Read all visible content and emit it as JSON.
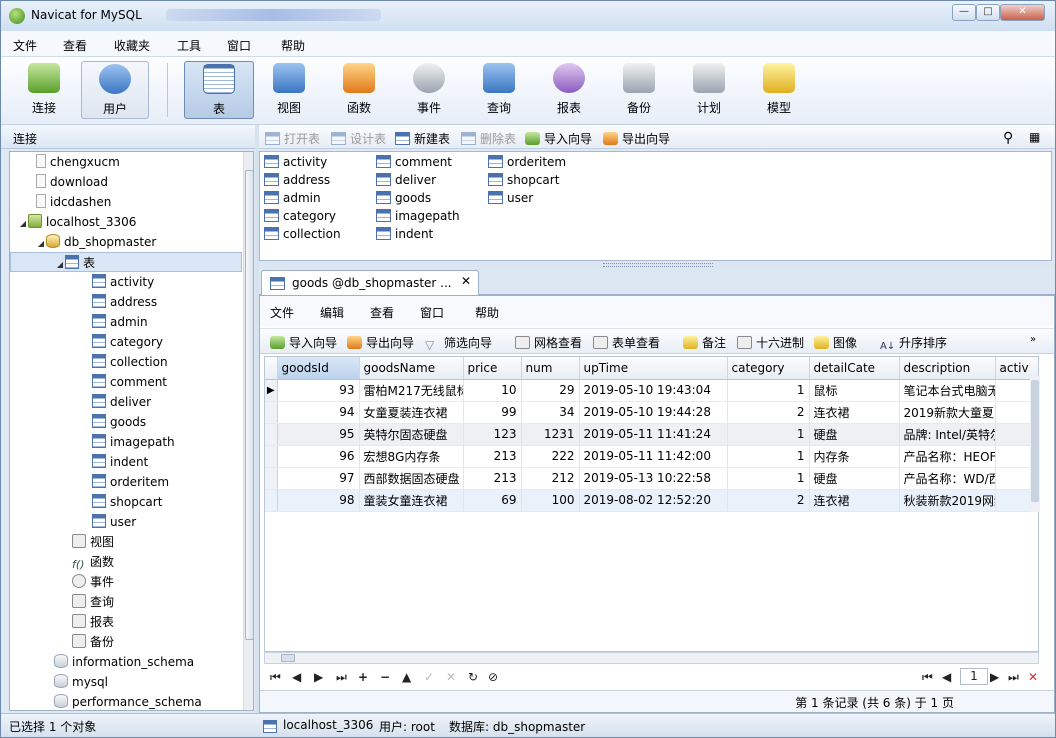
{
  "window": {
    "title": "Navicat for MySQL",
    "min": "—",
    "max": "□",
    "close": "✕"
  },
  "menu": [
    "文件",
    "查看",
    "收藏夹",
    "工具",
    "窗口",
    "帮助"
  ],
  "toolbar": [
    "连接",
    "用户",
    "表",
    "视图",
    "函数",
    "事件",
    "查询",
    "报表",
    "备份",
    "计划",
    "模型"
  ],
  "left_header": "连接",
  "tree": {
    "connections": [
      "chengxucm",
      "download",
      "idcdashen"
    ],
    "localhost": "localhost_3306",
    "db": "db_shopmaster",
    "tables_node": "表",
    "tables": [
      "activity",
      "address",
      "admin",
      "category",
      "collection",
      "comment",
      "deliver",
      "goods",
      "imagepath",
      "indent",
      "orderitem",
      "shopcart",
      "user"
    ],
    "others": [
      "视图",
      "函数",
      "事件",
      "查询",
      "报表",
      "备份"
    ],
    "other_dbs": [
      "information_schema",
      "mysql",
      "performance_schema"
    ]
  },
  "obj_toolbar": [
    "打开表",
    "设计表",
    "新建表",
    "删除表",
    "导入向导",
    "导出向导"
  ],
  "obj_list": [
    "activity",
    "address",
    "admin",
    "category",
    "collection",
    "comment",
    "deliver",
    "goods",
    "imagepath",
    "indent",
    "orderitem",
    "shopcart",
    "user"
  ],
  "tab": {
    "label": "goods @db_shopmaster ...",
    "close": "✕"
  },
  "inner_menu": [
    "文件",
    "编辑",
    "查看",
    "窗口",
    "帮助"
  ],
  "inner_toolbar": [
    "导入向导",
    "导出向导",
    "筛选向导",
    "网格查看",
    "表单查看",
    "备注",
    "十六进制",
    "图像",
    "升序排序"
  ],
  "grid": {
    "columns": [
      "goodsId",
      "goodsName",
      "price",
      "num",
      "upTime",
      "category",
      "detailCate",
      "description",
      "activ"
    ],
    "rows": [
      [
        "93",
        "雷柏M217无线鼠标",
        "10",
        "29",
        "2019-05-10 19:43:04",
        "1",
        "鼠标",
        "笔记本台式电脑无"
      ],
      [
        "94",
        "女童夏装连衣裙",
        "99",
        "34",
        "2019-05-10 19:44:28",
        "2",
        "连衣裙",
        "2019新款大童夏"
      ],
      [
        "95",
        "英特尔固态硬盘",
        "123",
        "1231",
        "2019-05-11 11:41:24",
        "1",
        "硬盘",
        "品牌: Intel/英特尔"
      ],
      [
        "96",
        "宏想8G内存条",
        "213",
        "222",
        "2019-05-11 11:42:00",
        "1",
        "内存条",
        "产品名称：HEOF"
      ],
      [
        "97",
        "西部数据固态硬盘",
        "213",
        "212",
        "2019-05-13 10:22:58",
        "1",
        "硬盘",
        "产品名称：WD/西"
      ],
      [
        "98",
        "童装女童连衣裙",
        "69",
        "100",
        "2019-08-02 12:52:20",
        "2",
        "连衣裙",
        "秋装新款2019网红"
      ]
    ]
  },
  "nav": {
    "first": "⏮",
    "prev": "◀",
    "next": "▶",
    "last": "⏭",
    "add": "+",
    "remove": "−",
    "up": "▲",
    "check": "✓",
    "cancel": "✕",
    "refresh": "↻",
    "stop": "⊘",
    "page": "1"
  },
  "record_info": "第 1 条记录 (共 6 条) 于 1 页",
  "status": {
    "selected": "已选择 1 个对象",
    "conn": "localhost_3306",
    "user": "用户: root",
    "db": "数据库: db_shopmaster"
  }
}
